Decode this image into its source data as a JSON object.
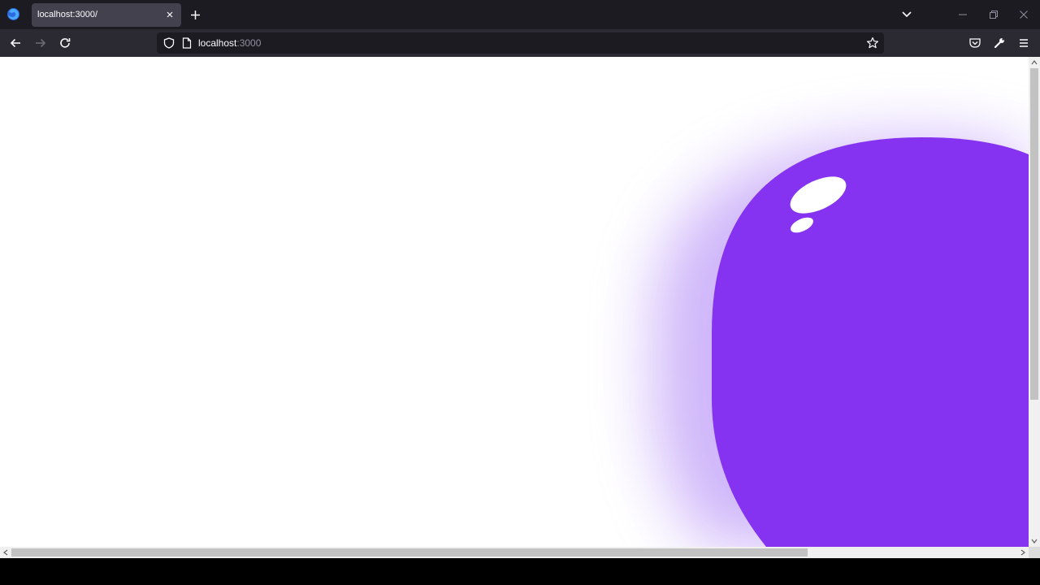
{
  "window": {
    "tab": {
      "title": "localhost:3000/"
    },
    "icons": {
      "browser": "firefox-icon",
      "tab_close": "close-icon",
      "new_tab": "plus-icon",
      "list_tabs": "chevron-down-icon",
      "minimize": "minimize-icon",
      "restore": "restore-icon",
      "close": "close-icon"
    }
  },
  "toolbar": {
    "url_host": "localhost",
    "url_port": ":3000",
    "icons": {
      "back": "arrow-left-icon",
      "forward": "arrow-right-icon",
      "reload": "reload-icon",
      "shield": "shield-icon",
      "page": "page-icon",
      "bookmark": "star-icon",
      "pocket": "pocket-icon",
      "tools": "wrench-icon",
      "menu": "hamburger-menu-icon"
    }
  },
  "content": {
    "blob_color": "#8533f0",
    "glow_color": "#a77af5",
    "highlight_color": "#ffffff",
    "background": "#ffffff"
  },
  "colors": {
    "tabstrip": "#1c1b22",
    "navbar": "#2b2a33",
    "urlbar": "#1c1b22",
    "active_tab": "#42414d",
    "text": "#fbfbfe"
  }
}
